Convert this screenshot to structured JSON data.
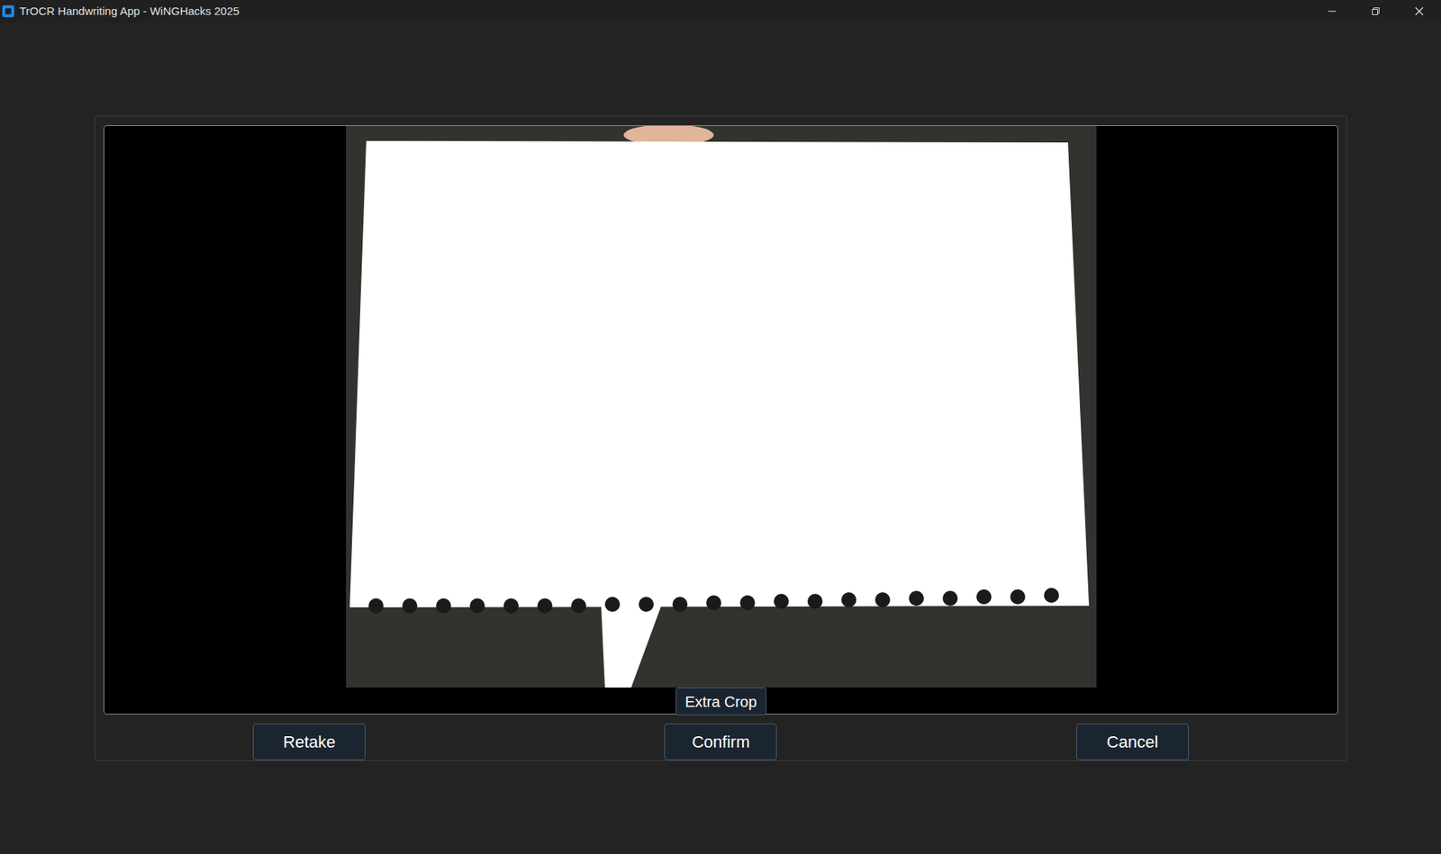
{
  "window": {
    "title": "TrOCR Handwriting App - WiNGHacks 2025"
  },
  "preview": {
    "extra_crop": "Extra Crop"
  },
  "buttons": [
    "Retake",
    "Confirm",
    "Cancel"
  ]
}
